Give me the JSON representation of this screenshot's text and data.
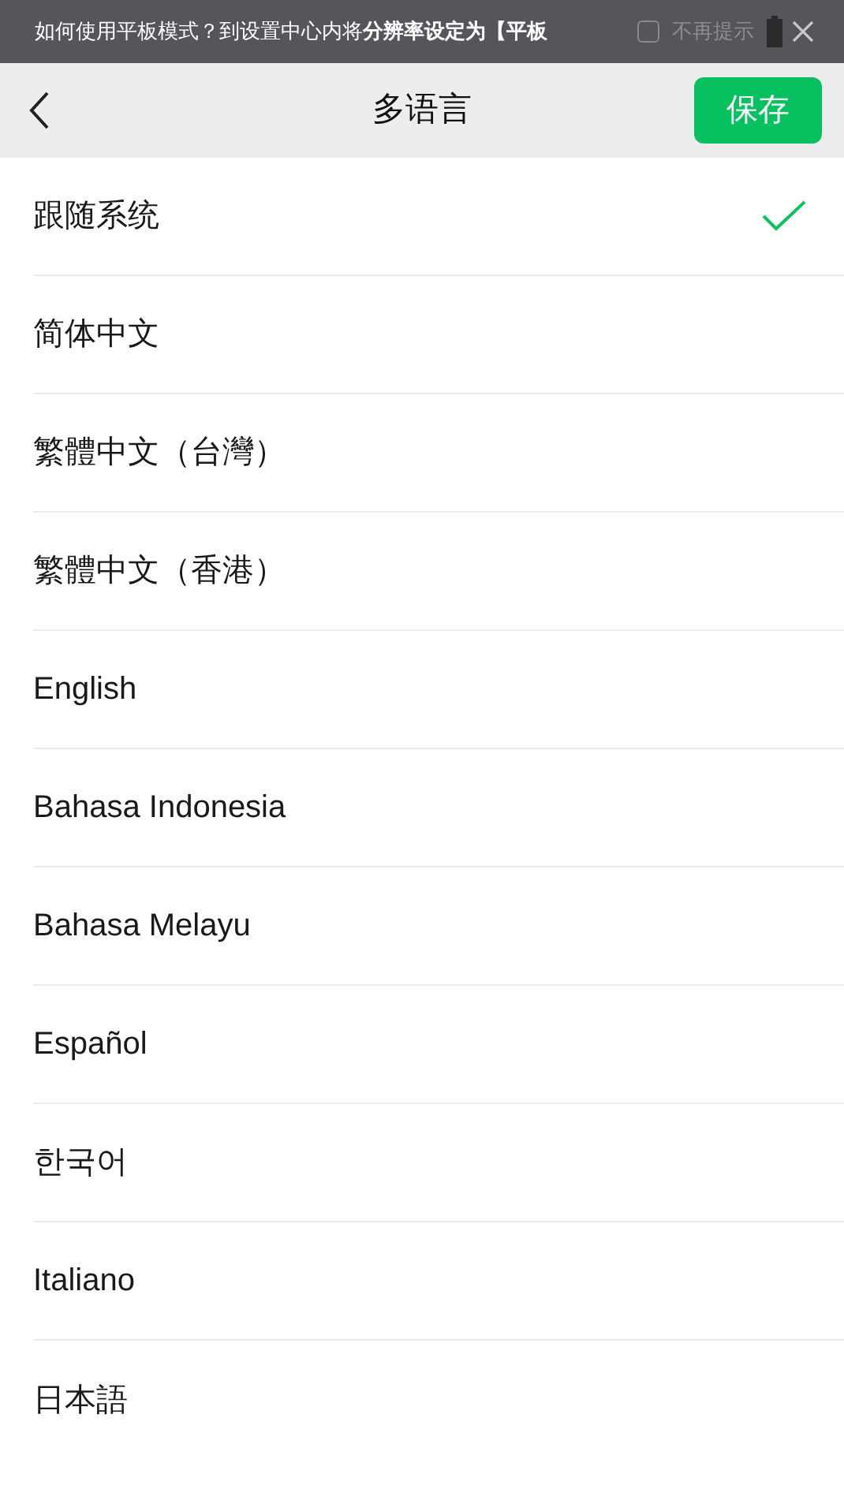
{
  "banner": {
    "message": "如何使用平板模式？到设置中心内将**分辨率设定为【平板**",
    "dont_show": {
      "label": "不再提示",
      "checked": false
    }
  },
  "header": {
    "title": "多语言",
    "save_button": "保存"
  },
  "languages": [
    {
      "label": "跟随系统",
      "selected": true
    },
    {
      "label": "简体中文",
      "selected": false
    },
    {
      "label": "繁體中文（台灣）",
      "selected": false
    },
    {
      "label": "繁體中文（香港）",
      "selected": false
    },
    {
      "label": "English",
      "selected": false
    },
    {
      "label": "Bahasa Indonesia",
      "selected": false
    },
    {
      "label": "Bahasa Melayu",
      "selected": false
    },
    {
      "label": "Español",
      "selected": false
    },
    {
      "label": "한국어",
      "selected": false
    },
    {
      "label": "Italiano",
      "selected": false
    },
    {
      "label": "日本語",
      "selected": false
    }
  ]
}
